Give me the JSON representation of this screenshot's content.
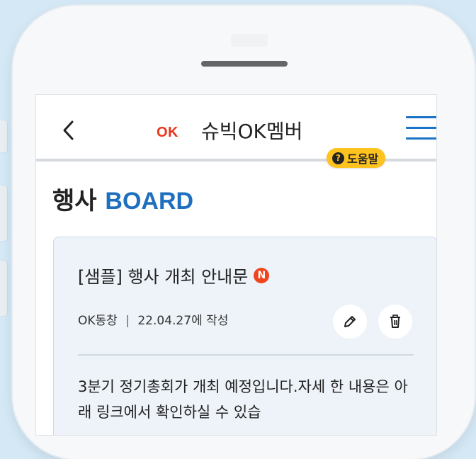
{
  "header": {
    "app_title": "슈빅OK멤버",
    "logo_text": "OK",
    "help_label": "도움말",
    "help_symbol": "?"
  },
  "page": {
    "title_prefix": "행사",
    "title_accent": "BOARD"
  },
  "post": {
    "title": "[샘플] 행사 개최 안내문",
    "new_badge": "N",
    "author": "OK동창",
    "meta_separator": "|",
    "date_text": "22.04.27에 작성",
    "body": "3분기 정기총회가 개최 예정입니다.자세 한 내용은 아래 링크에서 확인하실 수 있습"
  },
  "colors": {
    "accent_blue": "#1f6fbf",
    "logo_red": "#e8351c",
    "help_yellow": "#ffc320",
    "card_bg": "#edf3f9",
    "new_badge_red": "#f0441f"
  },
  "icons": {
    "back": "chevron-left-icon",
    "menu": "hamburger-menu-icon",
    "help": "question-circle-icon",
    "edit": "pencil-icon",
    "delete": "trash-icon"
  }
}
